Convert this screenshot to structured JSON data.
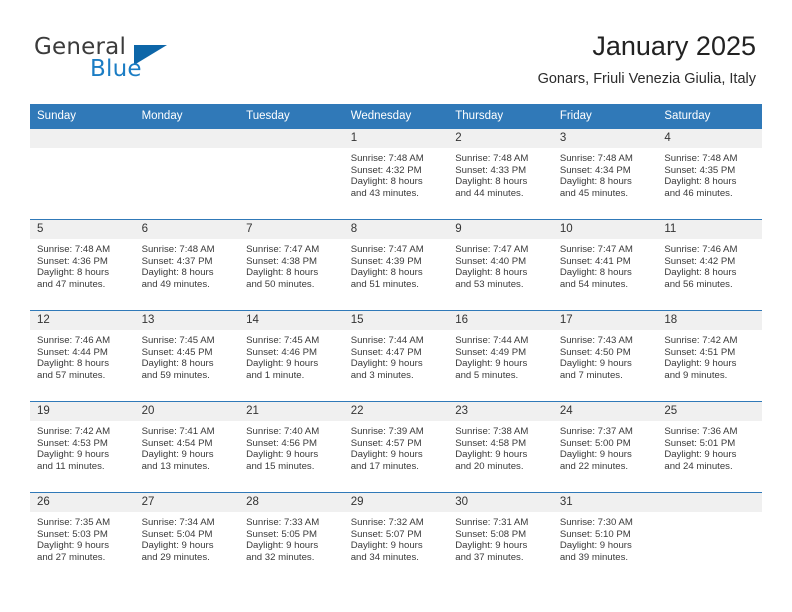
{
  "brand": {
    "word1": "General",
    "word2": "Blue",
    "triangle_color": "#0d66a8",
    "blue_color": "#1b7dc4"
  },
  "header": {
    "title": "January 2025",
    "subtitle": "Gonars, Friuli Venezia Giulia, Italy"
  },
  "theme": {
    "header_blue": "#3079b8",
    "daynum_band": "#f0f0f0"
  },
  "weekdays": [
    "Sunday",
    "Monday",
    "Tuesday",
    "Wednesday",
    "Thursday",
    "Friday",
    "Saturday"
  ],
  "weeks": [
    [
      {
        "day": "",
        "sunrise": "",
        "sunset": "",
        "daylight1": "",
        "daylight2": "",
        "empty": true
      },
      {
        "day": "",
        "sunrise": "",
        "sunset": "",
        "daylight1": "",
        "daylight2": "",
        "empty": true
      },
      {
        "day": "",
        "sunrise": "",
        "sunset": "",
        "daylight1": "",
        "daylight2": "",
        "empty": true
      },
      {
        "day": "1",
        "sunrise": "Sunrise: 7:48 AM",
        "sunset": "Sunset: 4:32 PM",
        "daylight1": "Daylight: 8 hours",
        "daylight2": "and 43 minutes.",
        "empty": false
      },
      {
        "day": "2",
        "sunrise": "Sunrise: 7:48 AM",
        "sunset": "Sunset: 4:33 PM",
        "daylight1": "Daylight: 8 hours",
        "daylight2": "and 44 minutes.",
        "empty": false
      },
      {
        "day": "3",
        "sunrise": "Sunrise: 7:48 AM",
        "sunset": "Sunset: 4:34 PM",
        "daylight1": "Daylight: 8 hours",
        "daylight2": "and 45 minutes.",
        "empty": false
      },
      {
        "day": "4",
        "sunrise": "Sunrise: 7:48 AM",
        "sunset": "Sunset: 4:35 PM",
        "daylight1": "Daylight: 8 hours",
        "daylight2": "and 46 minutes.",
        "empty": false
      }
    ],
    [
      {
        "day": "5",
        "sunrise": "Sunrise: 7:48 AM",
        "sunset": "Sunset: 4:36 PM",
        "daylight1": "Daylight: 8 hours",
        "daylight2": "and 47 minutes.",
        "empty": false
      },
      {
        "day": "6",
        "sunrise": "Sunrise: 7:48 AM",
        "sunset": "Sunset: 4:37 PM",
        "daylight1": "Daylight: 8 hours",
        "daylight2": "and 49 minutes.",
        "empty": false
      },
      {
        "day": "7",
        "sunrise": "Sunrise: 7:47 AM",
        "sunset": "Sunset: 4:38 PM",
        "daylight1": "Daylight: 8 hours",
        "daylight2": "and 50 minutes.",
        "empty": false
      },
      {
        "day": "8",
        "sunrise": "Sunrise: 7:47 AM",
        "sunset": "Sunset: 4:39 PM",
        "daylight1": "Daylight: 8 hours",
        "daylight2": "and 51 minutes.",
        "empty": false
      },
      {
        "day": "9",
        "sunrise": "Sunrise: 7:47 AM",
        "sunset": "Sunset: 4:40 PM",
        "daylight1": "Daylight: 8 hours",
        "daylight2": "and 53 minutes.",
        "empty": false
      },
      {
        "day": "10",
        "sunrise": "Sunrise: 7:47 AM",
        "sunset": "Sunset: 4:41 PM",
        "daylight1": "Daylight: 8 hours",
        "daylight2": "and 54 minutes.",
        "empty": false
      },
      {
        "day": "11",
        "sunrise": "Sunrise: 7:46 AM",
        "sunset": "Sunset: 4:42 PM",
        "daylight1": "Daylight: 8 hours",
        "daylight2": "and 56 minutes.",
        "empty": false
      }
    ],
    [
      {
        "day": "12",
        "sunrise": "Sunrise: 7:46 AM",
        "sunset": "Sunset: 4:44 PM",
        "daylight1": "Daylight: 8 hours",
        "daylight2": "and 57 minutes.",
        "empty": false
      },
      {
        "day": "13",
        "sunrise": "Sunrise: 7:45 AM",
        "sunset": "Sunset: 4:45 PM",
        "daylight1": "Daylight: 8 hours",
        "daylight2": "and 59 minutes.",
        "empty": false
      },
      {
        "day": "14",
        "sunrise": "Sunrise: 7:45 AM",
        "sunset": "Sunset: 4:46 PM",
        "daylight1": "Daylight: 9 hours",
        "daylight2": "and 1 minute.",
        "empty": false
      },
      {
        "day": "15",
        "sunrise": "Sunrise: 7:44 AM",
        "sunset": "Sunset: 4:47 PM",
        "daylight1": "Daylight: 9 hours",
        "daylight2": "and 3 minutes.",
        "empty": false
      },
      {
        "day": "16",
        "sunrise": "Sunrise: 7:44 AM",
        "sunset": "Sunset: 4:49 PM",
        "daylight1": "Daylight: 9 hours",
        "daylight2": "and 5 minutes.",
        "empty": false
      },
      {
        "day": "17",
        "sunrise": "Sunrise: 7:43 AM",
        "sunset": "Sunset: 4:50 PM",
        "daylight1": "Daylight: 9 hours",
        "daylight2": "and 7 minutes.",
        "empty": false
      },
      {
        "day": "18",
        "sunrise": "Sunrise: 7:42 AM",
        "sunset": "Sunset: 4:51 PM",
        "daylight1": "Daylight: 9 hours",
        "daylight2": "and 9 minutes.",
        "empty": false
      }
    ],
    [
      {
        "day": "19",
        "sunrise": "Sunrise: 7:42 AM",
        "sunset": "Sunset: 4:53 PM",
        "daylight1": "Daylight: 9 hours",
        "daylight2": "and 11 minutes.",
        "empty": false
      },
      {
        "day": "20",
        "sunrise": "Sunrise: 7:41 AM",
        "sunset": "Sunset: 4:54 PM",
        "daylight1": "Daylight: 9 hours",
        "daylight2": "and 13 minutes.",
        "empty": false
      },
      {
        "day": "21",
        "sunrise": "Sunrise: 7:40 AM",
        "sunset": "Sunset: 4:56 PM",
        "daylight1": "Daylight: 9 hours",
        "daylight2": "and 15 minutes.",
        "empty": false
      },
      {
        "day": "22",
        "sunrise": "Sunrise: 7:39 AM",
        "sunset": "Sunset: 4:57 PM",
        "daylight1": "Daylight: 9 hours",
        "daylight2": "and 17 minutes.",
        "empty": false
      },
      {
        "day": "23",
        "sunrise": "Sunrise: 7:38 AM",
        "sunset": "Sunset: 4:58 PM",
        "daylight1": "Daylight: 9 hours",
        "daylight2": "and 20 minutes.",
        "empty": false
      },
      {
        "day": "24",
        "sunrise": "Sunrise: 7:37 AM",
        "sunset": "Sunset: 5:00 PM",
        "daylight1": "Daylight: 9 hours",
        "daylight2": "and 22 minutes.",
        "empty": false
      },
      {
        "day": "25",
        "sunrise": "Sunrise: 7:36 AM",
        "sunset": "Sunset: 5:01 PM",
        "daylight1": "Daylight: 9 hours",
        "daylight2": "and 24 minutes.",
        "empty": false
      }
    ],
    [
      {
        "day": "26",
        "sunrise": "Sunrise: 7:35 AM",
        "sunset": "Sunset: 5:03 PM",
        "daylight1": "Daylight: 9 hours",
        "daylight2": "and 27 minutes.",
        "empty": false
      },
      {
        "day": "27",
        "sunrise": "Sunrise: 7:34 AM",
        "sunset": "Sunset: 5:04 PM",
        "daylight1": "Daylight: 9 hours",
        "daylight2": "and 29 minutes.",
        "empty": false
      },
      {
        "day": "28",
        "sunrise": "Sunrise: 7:33 AM",
        "sunset": "Sunset: 5:05 PM",
        "daylight1": "Daylight: 9 hours",
        "daylight2": "and 32 minutes.",
        "empty": false
      },
      {
        "day": "29",
        "sunrise": "Sunrise: 7:32 AM",
        "sunset": "Sunset: 5:07 PM",
        "daylight1": "Daylight: 9 hours",
        "daylight2": "and 34 minutes.",
        "empty": false
      },
      {
        "day": "30",
        "sunrise": "Sunrise: 7:31 AM",
        "sunset": "Sunset: 5:08 PM",
        "daylight1": "Daylight: 9 hours",
        "daylight2": "and 37 minutes.",
        "empty": false
      },
      {
        "day": "31",
        "sunrise": "Sunrise: 7:30 AM",
        "sunset": "Sunset: 5:10 PM",
        "daylight1": "Daylight: 9 hours",
        "daylight2": "and 39 minutes.",
        "empty": false
      },
      {
        "day": "",
        "sunrise": "",
        "sunset": "",
        "daylight1": "",
        "daylight2": "",
        "empty": true
      }
    ]
  ]
}
